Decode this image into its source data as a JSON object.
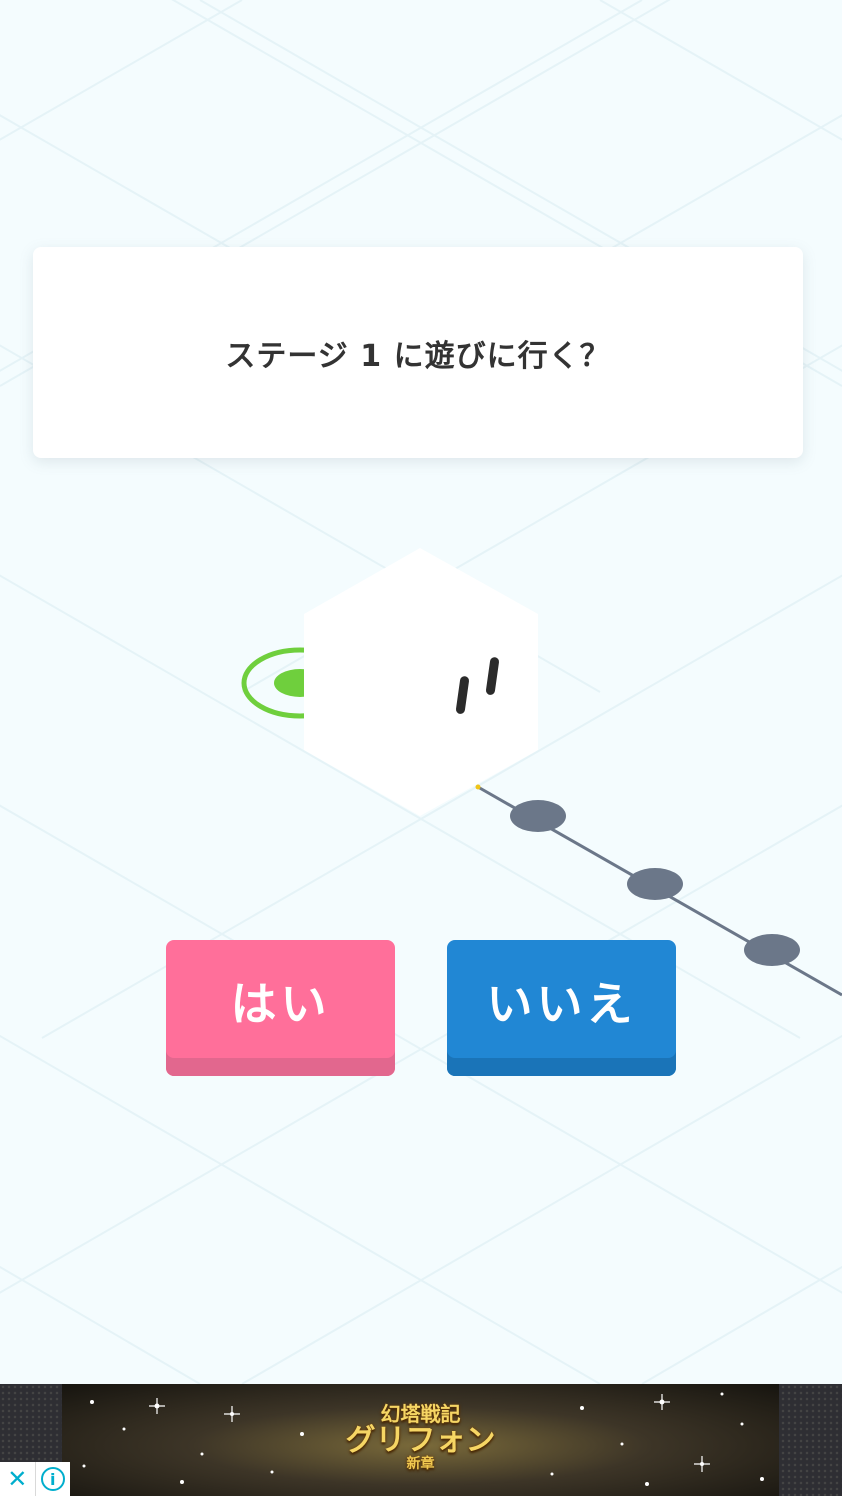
{
  "dialog": {
    "message": "ステージ 1 に遊びに行く？"
  },
  "buttons": {
    "yes_label": "はい",
    "no_label": "いいえ"
  },
  "colors": {
    "background": "#f4fcfe",
    "yes_button": "#ff6f9a",
    "no_button": "#2187d4",
    "path_node": "#6b7789",
    "start_ring": "#6fcf3d"
  },
  "ad": {
    "title_line1": "幻塔戦記",
    "title_line2": "グリフォン",
    "title_line3": "新章",
    "close_icon": "close-icon",
    "info_icon": "info-icon",
    "info_glyph": "i"
  }
}
